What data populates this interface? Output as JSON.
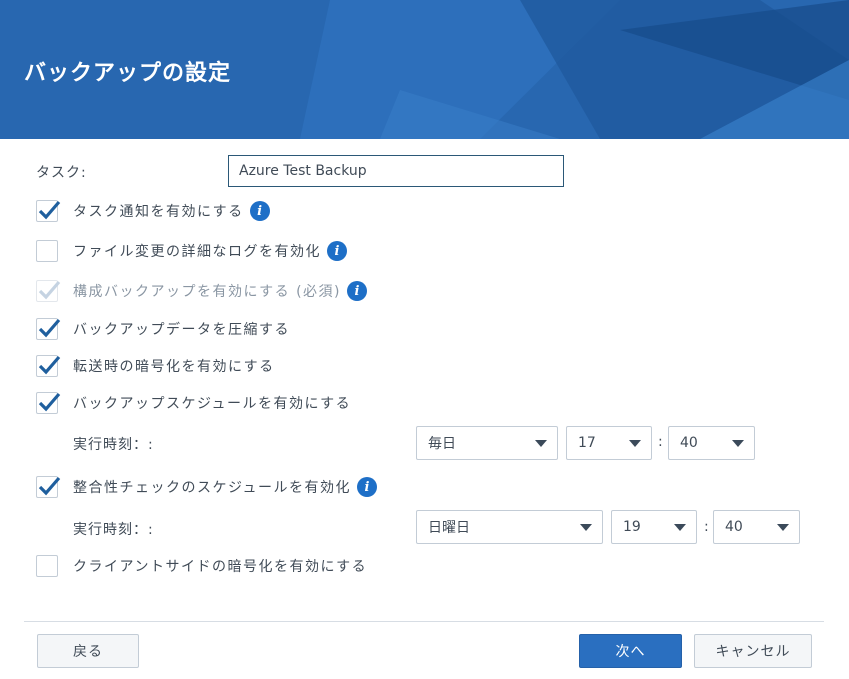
{
  "header": {
    "title": "バックアップの設定"
  },
  "task": {
    "label": "タスク:",
    "value": "Azure Test Backup"
  },
  "options": [
    {
      "label": "タスク通知を有効にする",
      "checked": true,
      "disabled": false,
      "info": true
    },
    {
      "label": "ファイル変更の詳細なログを有効化",
      "checked": false,
      "disabled": false,
      "info": true
    },
    {
      "label": "構成バックアップを有効にする (必須)",
      "checked": true,
      "disabled": true,
      "info": true
    },
    {
      "label": "バックアップデータを圧縮する",
      "checked": true,
      "disabled": false,
      "info": false
    },
    {
      "label": "転送時の暗号化を有効にする",
      "checked": true,
      "disabled": false,
      "info": false
    },
    {
      "label": "バックアップスケジュールを有効にする",
      "checked": true,
      "disabled": false,
      "info": false
    },
    {
      "label": "整合性チェックのスケジュールを有効化",
      "checked": true,
      "disabled": false,
      "info": true
    },
    {
      "label": "クライアントサイドの暗号化を有効にする",
      "checked": false,
      "disabled": false,
      "info": false
    }
  ],
  "backup_schedule": {
    "label": "実行時刻：:",
    "frequency": "毎日",
    "hour": "17",
    "minute": "40"
  },
  "integrity_schedule": {
    "label": "実行時刻：:",
    "frequency": "日曜日",
    "hour": "19",
    "minute": "40"
  },
  "time_separator": ":",
  "buttons": {
    "back": "戻る",
    "next": "次へ",
    "cancel": "キャンセル"
  },
  "colors": {
    "header": "#2a69b3",
    "primary": "#2a6fc0",
    "check": "#1f5f9e"
  }
}
